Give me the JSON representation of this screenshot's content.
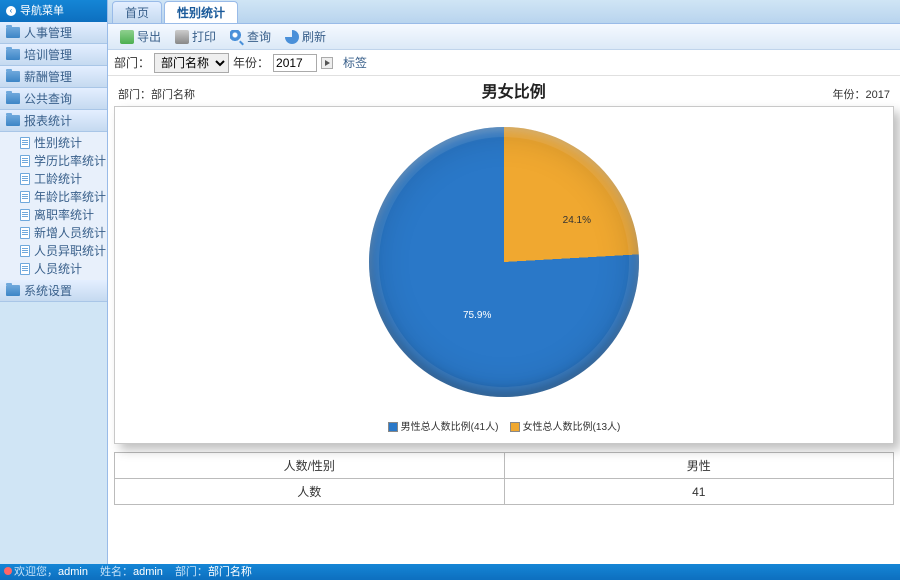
{
  "sidebar": {
    "title": "导航菜单",
    "groups": [
      {
        "label": "人事管理"
      },
      {
        "label": "培训管理"
      },
      {
        "label": "薪酬管理"
      },
      {
        "label": "公共查询"
      },
      {
        "label": "报表统计"
      },
      {
        "label": "系统设置"
      }
    ],
    "report_items": [
      "性别统计",
      "学历比率统计",
      "工龄统计",
      "年龄比率统计",
      "离职率统计",
      "新增人员统计",
      "人员异职统计",
      "人员统计"
    ]
  },
  "tabs": {
    "home": "首页",
    "active": "性别统计"
  },
  "toolbar": {
    "export": "导出",
    "print": "打印",
    "search": "查询",
    "refresh": "刷新"
  },
  "filter": {
    "dept_label": "部门：",
    "dept_value": "部门名称",
    "year_label": "年份：",
    "year_value": "2017",
    "tag": "标签"
  },
  "chart_header": {
    "dept": "部门：部门名称",
    "title": "男女比例",
    "year": "年份：2017"
  },
  "chart_data": {
    "type": "pie",
    "title": "男女比例",
    "series": [
      {
        "name": "男性总人数比例",
        "count": 41,
        "percent": 75.9,
        "color": "#2a78c8"
      },
      {
        "name": "女性总人数比例",
        "count": 13,
        "percent": 24.1,
        "color": "#f0a830"
      }
    ],
    "legend": [
      {
        "swatch": "#2a78c8",
        "label": "男性总人数比例(41人)"
      },
      {
        "swatch": "#f0a830",
        "label": "女性总人数比例(13人)"
      }
    ],
    "labels": {
      "pct_female": "24.1%",
      "pct_male": "75.9%"
    }
  },
  "table": {
    "header_left": "人数/性别",
    "header_col": "男性",
    "row_label": "人数",
    "row_value": "41"
  },
  "status": {
    "welcome_label": "欢迎您，",
    "welcome_value": "admin",
    "name_label": "姓名：",
    "name_value": "admin",
    "dept_label": "部门：",
    "dept_value": "部门名称"
  }
}
